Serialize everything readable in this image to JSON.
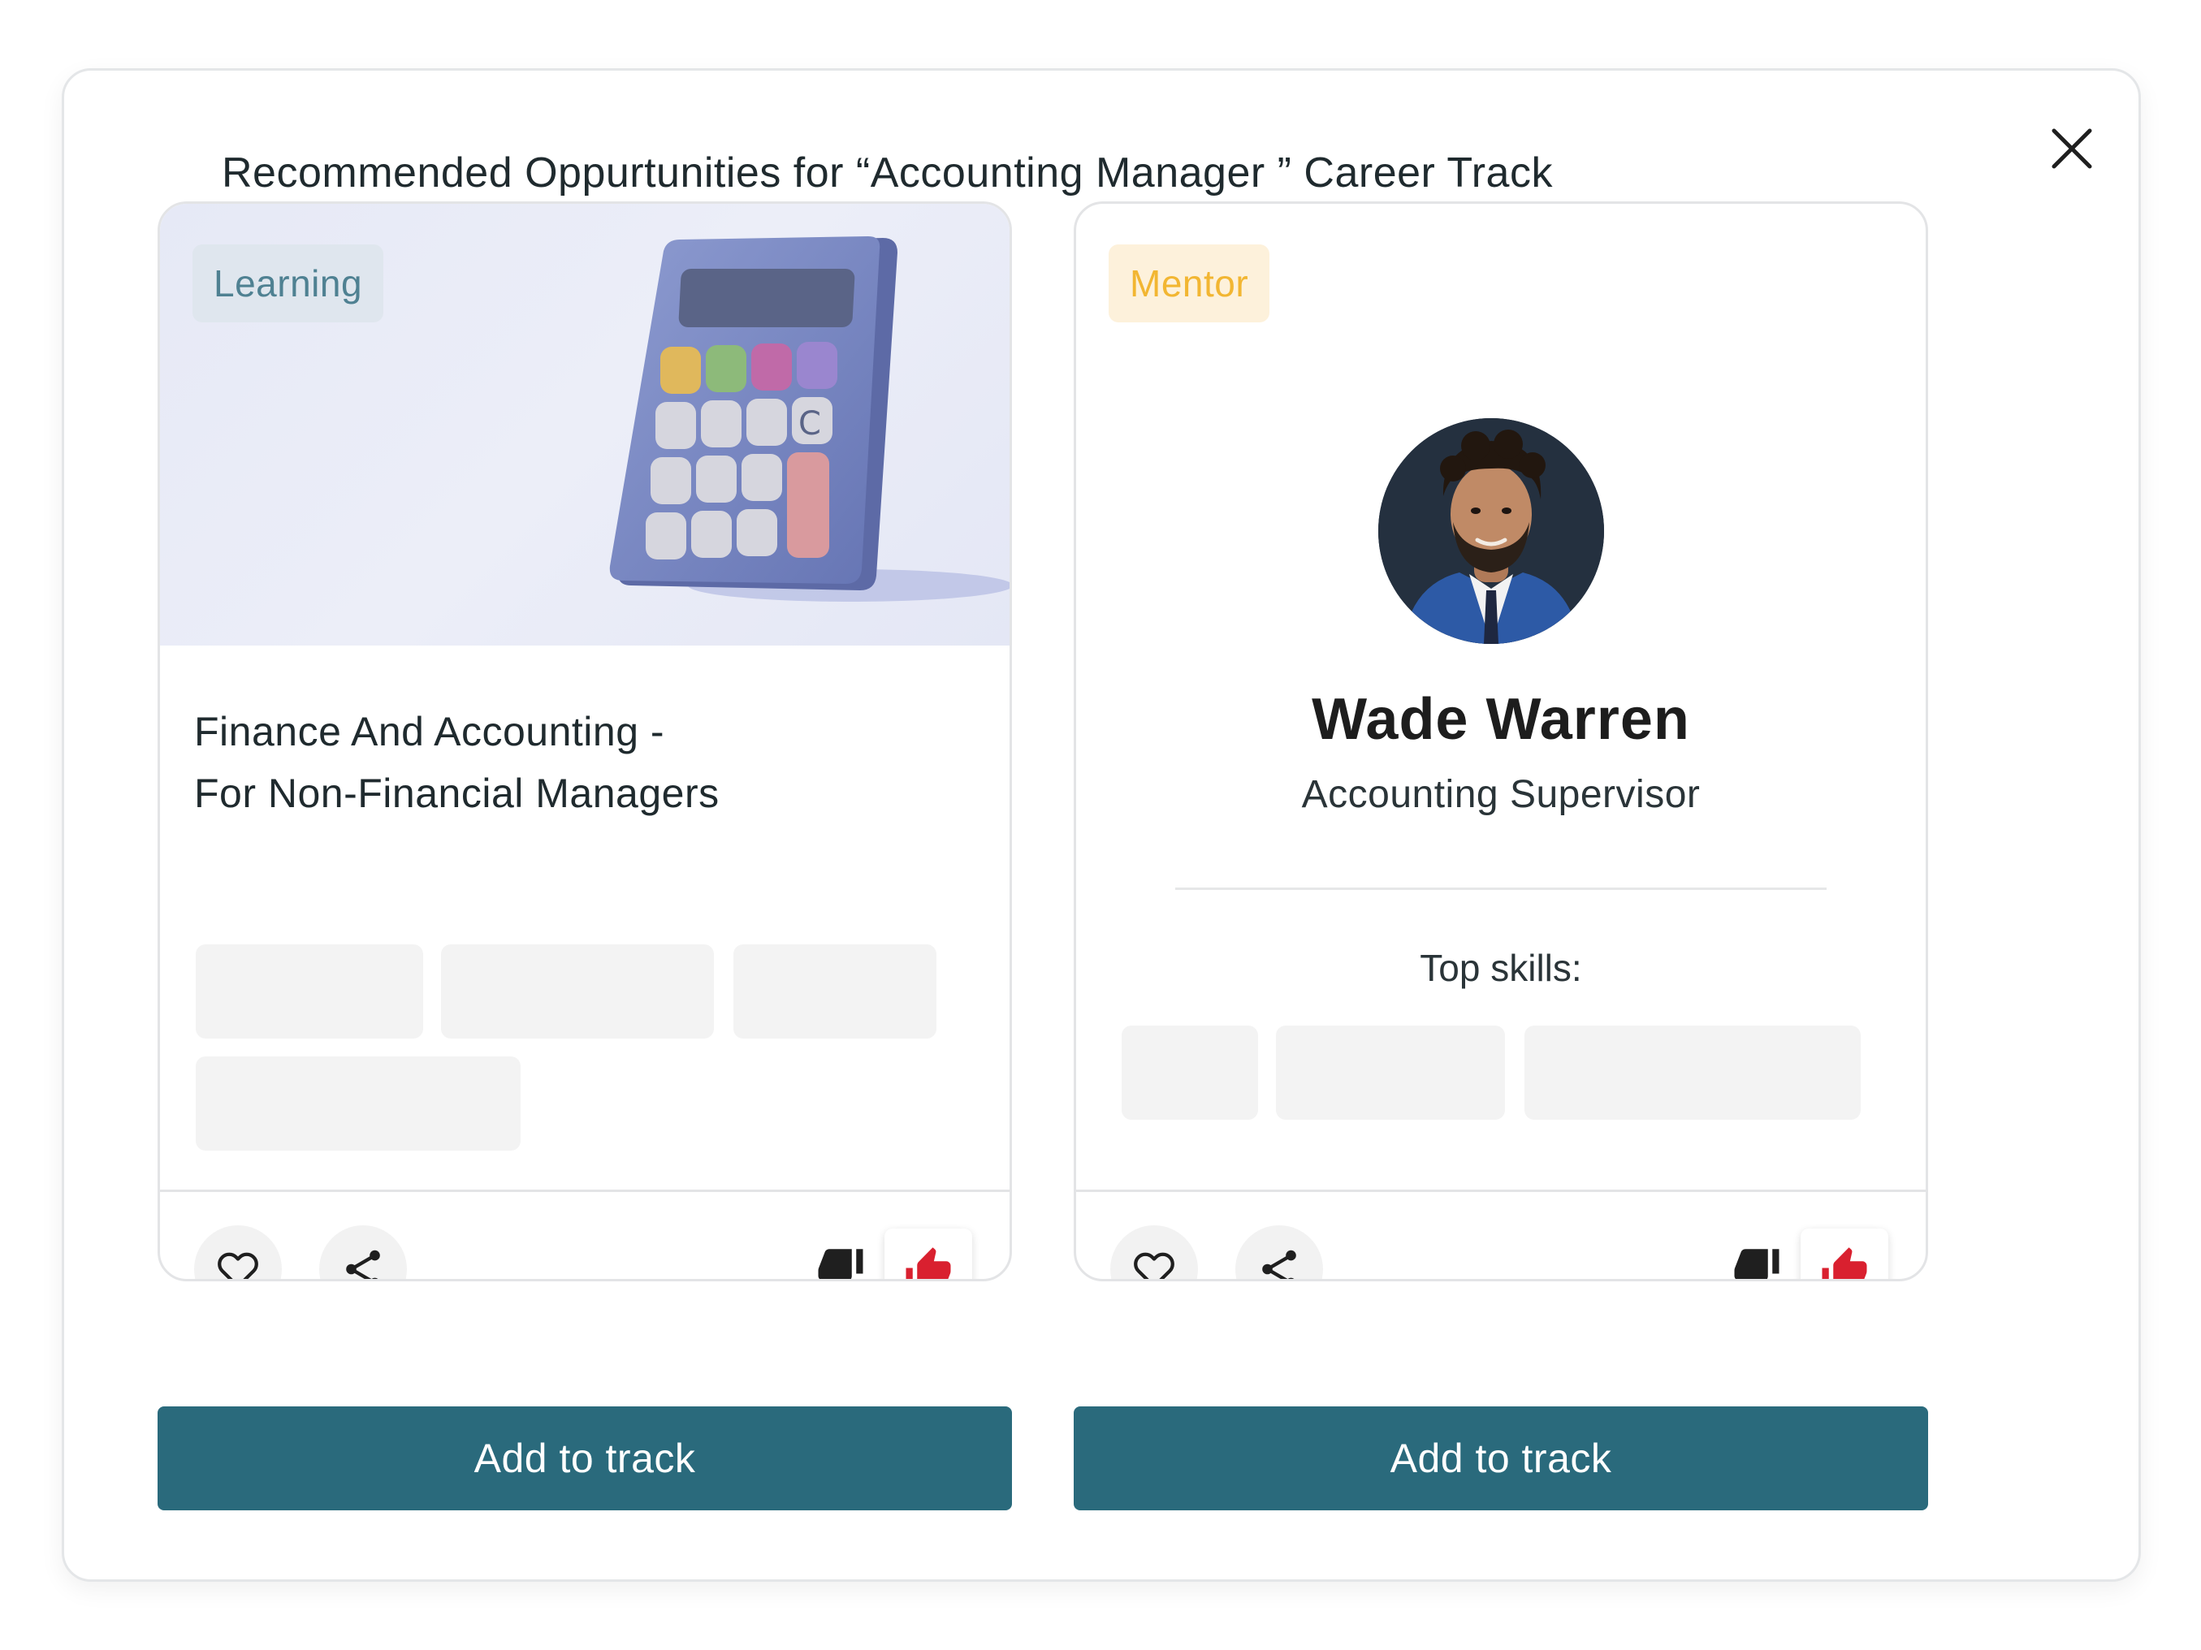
{
  "modal": {
    "title": "Recommended Oppurtunities for “Accounting Manager ” Career Track",
    "close_icon": "close-icon"
  },
  "learning_card": {
    "tag": "Learning",
    "image": "calculator-illustration",
    "title_line1": "Finance And Accounting -",
    "title_line2": "For Non-Financial Managers",
    "actions": [
      "heart-icon",
      "share-icon",
      "thumbs-down-icon",
      "thumbs-up-icon"
    ],
    "add_label": "Add to track"
  },
  "mentor_card": {
    "tag": "Mentor",
    "name": "Wade Warren",
    "role": "Accounting Supervisor",
    "skills_label": "Top skills:",
    "actions": [
      "heart-icon",
      "share-icon",
      "thumbs-down-icon",
      "thumbs-up-icon"
    ],
    "add_label": "Add to track"
  },
  "colors": {
    "primary": "#2a6a7c",
    "learning_tag_text": "#4f8192",
    "mentor_tag_text": "#f2b632",
    "thumb_up": "#d9202f"
  }
}
